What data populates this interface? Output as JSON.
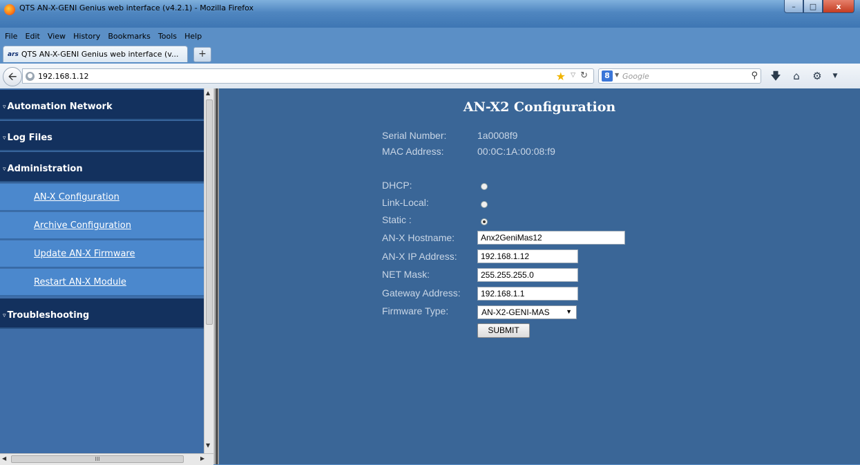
{
  "window": {
    "title": "QTS AN-X-GENI Genius web interface (v4.2.1) - Mozilla Firefox",
    "min_glyph": "–",
    "max_glyph": "□",
    "close_glyph": "x"
  },
  "menu": [
    "File",
    "Edit",
    "View",
    "History",
    "Bookmarks",
    "Tools",
    "Help"
  ],
  "tab": {
    "favicon_text": "ars",
    "label": "QTS AN-X-GENI Genius web interface (v...",
    "new_tab": "+"
  },
  "nav": {
    "url": "192.168.1.12",
    "search_engine": "8",
    "search_placeholder": "Google",
    "icons": [
      "back-arrow-icon",
      "globe-icon",
      "bookmark-star-icon",
      "reload-icon",
      "search-icon",
      "download-icon",
      "home-icon",
      "addon-icon"
    ]
  },
  "sidebar": {
    "sections": [
      {
        "label": "Automation Network"
      },
      {
        "label": "Log Files"
      },
      {
        "label": "Administration"
      },
      {
        "label": "Troubleshooting"
      }
    ],
    "admin_items": [
      {
        "label": "AN-X Configuration"
      },
      {
        "label": "Archive Configuration"
      },
      {
        "label": "Update AN-X Firmware"
      },
      {
        "label": "Restart AN-X Module"
      }
    ],
    "hscroll_grip": "III"
  },
  "main": {
    "title": "AN-X2 Configuration",
    "serial_label": "Serial Number:",
    "serial_value": "1a0008f9",
    "mac_label": "MAC Address:",
    "mac_value": "00:0C:1A:00:08:f9",
    "dhcp_label": "DHCP:",
    "linklocal_label": "Link-Local:",
    "static_label": "Static :",
    "ip_mode_selected": "Static",
    "hostname_label": "AN-X Hostname:",
    "hostname_value": "Anx2GeniMas12",
    "ip_label": "AN-X IP Address:",
    "ip_value": "192.168.1.12",
    "mask_label": "NET Mask:",
    "mask_value": "255.255.255.0",
    "gateway_label": "Gateway Address:",
    "gateway_value": "192.168.1.1",
    "firmware_label": "Firmware Type:",
    "firmware_value": "AN-X2-GENI-MAS",
    "submit_label": "SUBMIT"
  },
  "colors": {
    "sidebar_section": "#13315e",
    "sidebar_item": "#4b88cd",
    "main_bg": "#3a6697",
    "label_text": "#c9d6e6"
  }
}
